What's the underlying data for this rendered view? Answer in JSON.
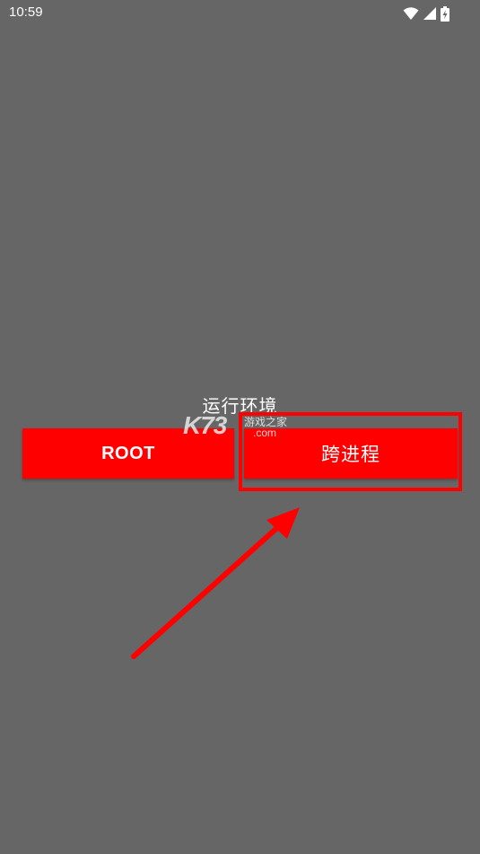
{
  "status_bar": {
    "time": "10:59",
    "icons": [
      "wifi-icon",
      "cellular-signal-icon",
      "battery-charging-icon"
    ]
  },
  "screen": {
    "title": "运行环境",
    "buttons": {
      "root_label": "ROOT",
      "cross_process_label": "跨进程"
    }
  },
  "watermark": {
    "brand": "K73",
    "name": "游戏之家",
    "domain": ".com"
  },
  "colors": {
    "background": "#666666",
    "button": "#ff0000",
    "annotation": "#ff0000",
    "text": "#ffffff"
  }
}
